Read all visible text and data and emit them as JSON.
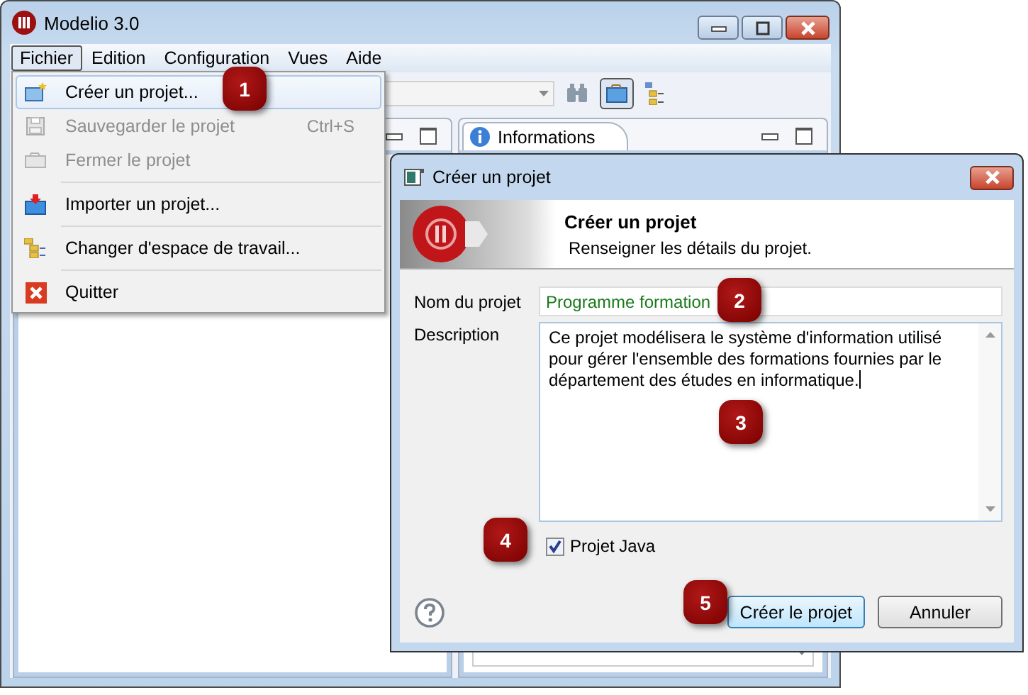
{
  "main_window": {
    "title": "Modelio 3.0"
  },
  "menu_bar": [
    {
      "label": "Fichier",
      "selected": true
    },
    {
      "label": "Edition",
      "selected": false
    },
    {
      "label": "Configuration",
      "selected": false
    },
    {
      "label": "Vues",
      "selected": false
    },
    {
      "label": "Aide",
      "selected": false
    }
  ],
  "file_menu": {
    "groups": [
      [
        {
          "label": "Créer un projet...",
          "disabled": false,
          "selected": true
        },
        {
          "label": "Sauvegarder le projet",
          "shortcut": "Ctrl+S",
          "disabled": true,
          "selected": false
        },
        {
          "label": "Fermer le projet",
          "disabled": true,
          "selected": false
        }
      ],
      [
        {
          "label": "Importer un projet...",
          "disabled": false,
          "selected": false
        }
      ],
      [
        {
          "label": "Changer d'espace de travail...",
          "disabled": false,
          "selected": false
        }
      ],
      [
        {
          "label": "Quitter",
          "disabled": false,
          "selected": false
        }
      ]
    ]
  },
  "right_panel": {
    "tab": "Informations"
  },
  "dialog": {
    "title": "Créer un projet",
    "header_title": "Créer un projet",
    "header_subtitle": "Renseigner les détails du projet.",
    "name_label": "Nom du projet",
    "name_value": "Programme formation",
    "description_label": "Description",
    "description_value": "Ce projet modélisera le système d'information utilisé pour gérer l'ensemble des formations fournies par le département des études en informatique.",
    "java_checkbox": {
      "label": "Projet Java",
      "checked": true
    },
    "buttons": [
      {
        "label": "Créer le projet",
        "default": true
      },
      {
        "label": "Annuler",
        "default": false
      }
    ]
  },
  "callouts": [
    "1",
    "2",
    "3",
    "4",
    "5"
  ]
}
